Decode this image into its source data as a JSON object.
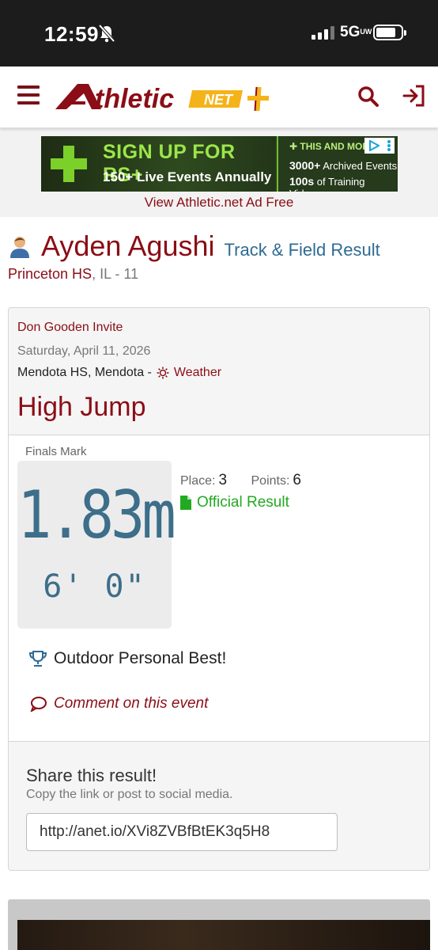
{
  "status": {
    "time": "12:59",
    "network": "5G",
    "network_sub": "UW"
  },
  "ad": {
    "headline": "SIGN UP FOR RS+",
    "subline": "150+ Live Events Annually",
    "right_top": "THIS AND MORE",
    "right_line1_num": "3000+",
    "right_line1": "Archived Events",
    "right_line2_num": "100s",
    "right_line2": "of Training Videos",
    "ad_free_link": "View Athletic.net Ad Free"
  },
  "athlete": {
    "name": "Ayden Agushi",
    "result_type": "Track & Field Result",
    "school": "Princeton HS",
    "school_rest": ", IL - 11"
  },
  "meet": {
    "name": "Don Gooden Invite",
    "date": "Saturday, April 11, 2026",
    "location": "Mendota HS, Mendota -",
    "weather_link": "Weather"
  },
  "result": {
    "event": "High Jump",
    "finals_label": "Finals Mark",
    "mark_metric": "1.83m",
    "mark_imperial": "6' 0\"",
    "place_label": "Place:",
    "place": "3",
    "points_label": "Points:",
    "points": "6",
    "official": "Official Result",
    "personal_best": "Outdoor Personal Best!",
    "comment_link": "Comment on this event"
  },
  "share": {
    "title": "Share this result!",
    "subtitle": "Copy the link or post to social media.",
    "link": "http://anet.io/XVi8ZVBfBtEK3q5H8"
  },
  "colors": {
    "brand": "#8b0d16",
    "link_blue": "#2e6b94",
    "official_green": "#22aa22",
    "mark_blue": "#3d6e8a"
  }
}
